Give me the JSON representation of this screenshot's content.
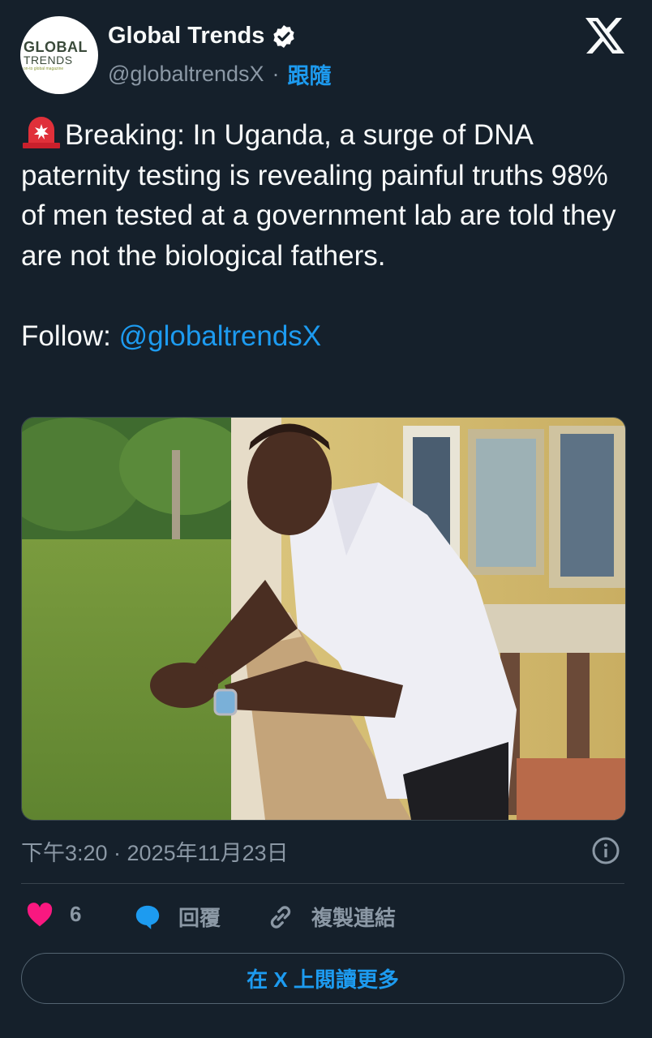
{
  "author": {
    "avatar_line1": "GLOBAL",
    "avatar_line2": "TRENDS",
    "avatar_tagline": "on-to global magazine",
    "display_name": "Global Trends",
    "handle": "@globaltrendsX",
    "separator": "·",
    "follow_label": "跟隨",
    "verified_icon": "verified-badge-icon"
  },
  "platform_icon": "x-logo-icon",
  "tweet": {
    "emoji": "rotating-light-emoji",
    "text_main": "Breaking: In Uganda, a surge of DNA paternity testing is revealing painful truths 98% of men tested at a government lab are told they are not the biological fathers.",
    "follow_prefix": "Follow: ",
    "follow_mention": "@globaltrendsX"
  },
  "media": {
    "icon": "photo-man-leaning-on-railing"
  },
  "meta": {
    "timestamp": "下午3:20 · 2025年11月23日",
    "info_icon": "info-icon"
  },
  "actions": {
    "like_count": "6",
    "reply_label": "回覆",
    "copy_link_label": "複製連結",
    "read_more_label": "在 X 上閱讀更多"
  },
  "colors": {
    "background": "#15202b",
    "accent": "#1d9bf0",
    "like": "#f91880",
    "muted": "#8b98a5"
  }
}
